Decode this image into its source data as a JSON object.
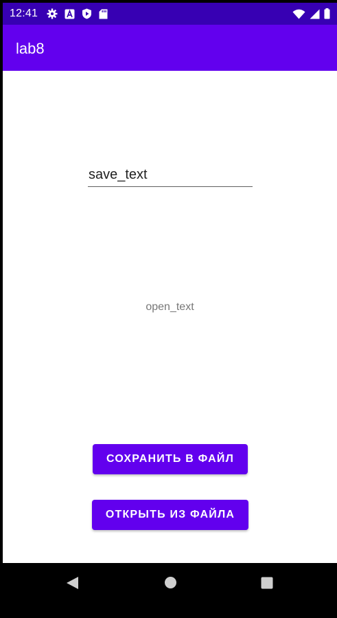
{
  "status_bar": {
    "time": "12:41",
    "icons_left": [
      "gear-icon",
      "font-a-icon",
      "play-shield-icon",
      "sd-card-icon"
    ],
    "icons_right": [
      "wifi-icon",
      "cell-signal-icon",
      "battery-icon"
    ],
    "color": "#3700B3"
  },
  "app_bar": {
    "title": "lab8",
    "color": "#6200EE"
  },
  "main": {
    "save_field_value": "save_text",
    "open_text": "open_text",
    "save_button_label": "СОХРАНИТЬ В ФАЙЛ",
    "open_button_label": "ОТКРЫТЬ ИЗ ФАЙЛА",
    "button_color": "#6200EE"
  },
  "nav_bar": {
    "icons": [
      "back-icon",
      "home-icon",
      "recents-icon"
    ]
  }
}
